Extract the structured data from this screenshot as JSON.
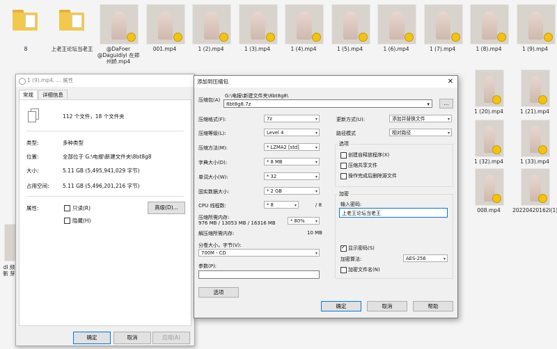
{
  "grid_row1": [
    {
      "label": "8",
      "type": "folder"
    },
    {
      "label": "上老王论坛当老王",
      "type": "folder"
    },
    {
      "label": "@DaFoer @Daguidiyi 在郑州娇.mp4",
      "type": "video"
    },
    {
      "label": "001.mp4",
      "type": "video"
    },
    {
      "label": "1 (2).mp4",
      "type": "video"
    },
    {
      "label": "1 (3).mp4",
      "type": "video"
    },
    {
      "label": "1 (4).mp4",
      "type": "video"
    },
    {
      "label": "1 (5).mp4",
      "type": "video"
    },
    {
      "label": "1 (6).mp4",
      "type": "video"
    },
    {
      "label": "1 (7).mp4",
      "type": "video"
    },
    {
      "label": "1 (8).mp4",
      "type": "video"
    },
    {
      "label": "1 (9).mp4",
      "type": "video"
    }
  ],
  "grid_right": [
    {
      "label": "1 (20).mp4"
    },
    {
      "label": "1 (21).mp4"
    },
    {
      "label": "1 (32).mp4"
    },
    {
      "label": "1 (33).mp4"
    },
    {
      "label": "008.mp4"
    },
    {
      "label": "20220420162l(1).mp4"
    }
  ],
  "left_partial_label": "dl 频 新 芽",
  "props": {
    "title": "1 (9).mp4, ... 属性",
    "tab_general": "常规",
    "tab_details": "详细信息",
    "summary": "112 个文件，18 个文件夹",
    "type_label": "类型:",
    "type_value": "多种类型",
    "loc_label": "位置:",
    "loc_value": "全部位于 G:\\电报\\新建文件夹\\8bt8g8",
    "size_label": "大小:",
    "size_value": "5.11 GB (5,495,941,029 字节)",
    "disk_label": "占用空间:",
    "disk_value": "5.11 GB (5,496,201,216 字节)",
    "attr_label": "属性:",
    "readonly_label": "只读(R)",
    "hidden_label": "隐藏(H)",
    "advanced_btn": "高级(D)...",
    "ok_btn": "确定",
    "cancel_btn": "取消",
    "apply_btn": "应用(A)"
  },
  "archive": {
    "title": "添加到压缩包",
    "archive_label": "压缩包(A)",
    "archive_path": "G:\\电报\\新建文件夹\\8bt8g8\\",
    "archive_name": "8bt8g8.7z",
    "browse_btn": "...",
    "format_label": "压缩格式(F):",
    "format_value": "7z",
    "level_label": "压缩等级(L):",
    "level_value": "Level 4",
    "method_label": "压缩方法(M):",
    "method_value": "* LZMA2 [std]",
    "dict_label": "字典大小(D):",
    "dict_value": "* 8 MB",
    "word_label": "单词大小(W):",
    "word_value": "* 32",
    "solid_label": "固实数据大小:",
    "solid_value": "* 2 GB",
    "cpu_label": "CPU 线程数:",
    "cpu_value": "* 8",
    "cpu_total": "/ 8",
    "mem_label": "压缩所需内存:",
    "mem_detail": "976 MB / 13053 MB / 16316 MB",
    "mem_pct": "* 80%",
    "dmem_label": "解压缩所需内存:",
    "dmem_value": "10 MB",
    "split_label": "分卷大小，字节(V):",
    "split_value": "700M - CD",
    "param_label": "参数(P):",
    "options_btn": "选项",
    "update_label": "更新方式(U):",
    "update_value": "添加并替换文件",
    "path_label": "路径模式",
    "path_value": "相对路径",
    "opt_group": "选项",
    "opt_sfx": "创建自释放程序(X)",
    "opt_shared": "压缩共享文件",
    "opt_delete": "操作完成后删除源文件",
    "enc_group": "加密",
    "pwd_label": "输入密码:",
    "pwd_value": "上老王论坛当老王",
    "show_pwd": "显示密码(S)",
    "enc_method_label": "加密算法:",
    "enc_method_value": "AES-256",
    "enc_names": "加密文件名(N)",
    "ok_btn": "确定",
    "cancel_btn": "取消",
    "help_btn": "帮助"
  }
}
